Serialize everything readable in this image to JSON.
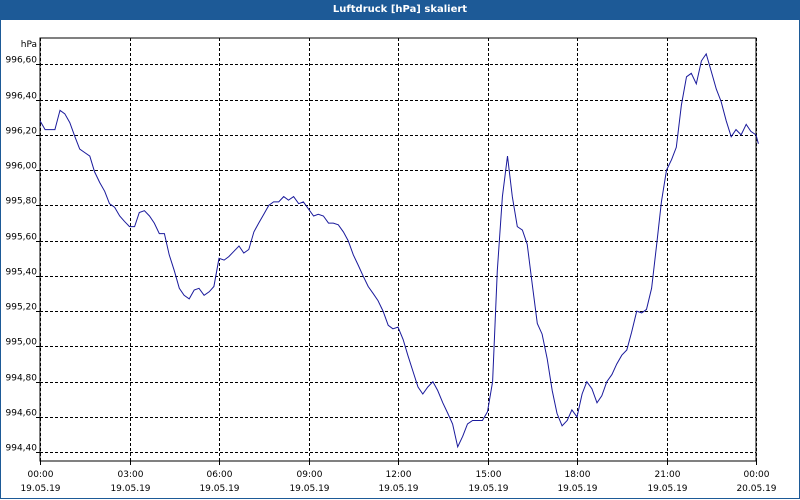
{
  "title": "Luftdruck [hPa] skaliert",
  "colors": {
    "title_bg": "#1d5a97",
    "title_fg": "#ffffff",
    "line": "#1a1a9c",
    "grid": "#000000",
    "frame": "#1d5a97"
  },
  "chart_data": {
    "type": "line",
    "title": "Luftdruck [hPa] skaliert",
    "ylabel": "hPa",
    "xlabel": "",
    "grid": true,
    "xlim": [
      0,
      24
    ],
    "ylim": [
      994.35,
      996.75
    ],
    "y_ticks": [
      994.4,
      994.6,
      994.8,
      995.0,
      995.2,
      995.4,
      995.6,
      995.8,
      996.0,
      996.2,
      996.4,
      996.6
    ],
    "y_tick_labels": [
      "994,40",
      "994,60",
      "994,80",
      "995,00",
      "995,20",
      "995,40",
      "995,60",
      "995,80",
      "996,00",
      "996,20",
      "996,40",
      "996,60"
    ],
    "x_ticks": [
      0,
      3,
      6,
      9,
      12,
      15,
      18,
      21,
      24
    ],
    "x_tick_labels": [
      [
        "00:00",
        "19.05.19"
      ],
      [
        "03:00",
        "19.05.19"
      ],
      [
        "06:00",
        "19.05.19"
      ],
      [
        "09:00",
        "19.05.19"
      ],
      [
        "12:00",
        "19.05.19"
      ],
      [
        "15:00",
        "19.05.19"
      ],
      [
        "18:00",
        "19.05.19"
      ],
      [
        "21:00",
        "19.05.19"
      ],
      [
        "00:00",
        "20.05.19"
      ]
    ],
    "series": [
      {
        "points": [
          [
            0.0,
            996.28
          ],
          [
            0.17,
            996.23
          ],
          [
            0.5,
            996.23
          ],
          [
            0.67,
            996.34
          ],
          [
            0.83,
            996.32
          ],
          [
            1.0,
            996.27
          ],
          [
            1.17,
            996.19
          ],
          [
            1.33,
            996.12
          ],
          [
            1.5,
            996.1
          ],
          [
            1.67,
            996.08
          ],
          [
            1.83,
            995.99
          ],
          [
            2.0,
            995.93
          ],
          [
            2.17,
            995.88
          ],
          [
            2.33,
            995.81
          ],
          [
            2.5,
            995.79
          ],
          [
            2.67,
            995.74
          ],
          [
            2.83,
            995.71
          ],
          [
            3.0,
            995.68
          ],
          [
            3.17,
            995.68
          ],
          [
            3.33,
            995.76
          ],
          [
            3.5,
            995.77
          ],
          [
            3.67,
            995.74
          ],
          [
            3.83,
            995.7
          ],
          [
            4.0,
            995.64
          ],
          [
            4.17,
            995.64
          ],
          [
            4.33,
            995.52
          ],
          [
            4.5,
            995.43
          ],
          [
            4.67,
            995.33
          ],
          [
            4.83,
            995.29
          ],
          [
            5.0,
            995.27
          ],
          [
            5.17,
            995.32
          ],
          [
            5.33,
            995.33
          ],
          [
            5.5,
            995.29
          ],
          [
            5.67,
            995.31
          ],
          [
            5.83,
            995.34
          ],
          [
            6.0,
            995.5
          ],
          [
            6.17,
            995.49
          ],
          [
            6.33,
            995.51
          ],
          [
            6.5,
            995.54
          ],
          [
            6.67,
            995.57
          ],
          [
            6.83,
            995.53
          ],
          [
            7.0,
            995.55
          ],
          [
            7.17,
            995.65
          ],
          [
            7.33,
            995.7
          ],
          [
            7.5,
            995.75
          ],
          [
            7.67,
            995.8
          ],
          [
            7.83,
            995.82
          ],
          [
            8.0,
            995.82
          ],
          [
            8.17,
            995.85
          ],
          [
            8.33,
            995.83
          ],
          [
            8.5,
            995.85
          ],
          [
            8.67,
            995.81
          ],
          [
            8.83,
            995.82
          ],
          [
            9.0,
            995.78
          ],
          [
            9.17,
            995.74
          ],
          [
            9.33,
            995.75
          ],
          [
            9.5,
            995.74
          ],
          [
            9.67,
            995.7
          ],
          [
            9.83,
            995.7
          ],
          [
            10.0,
            995.69
          ],
          [
            10.17,
            995.65
          ],
          [
            10.33,
            995.6
          ],
          [
            10.5,
            995.52
          ],
          [
            10.67,
            995.46
          ],
          [
            10.83,
            995.4
          ],
          [
            11.0,
            995.34
          ],
          [
            11.17,
            995.3
          ],
          [
            11.33,
            995.26
          ],
          [
            11.5,
            995.2
          ],
          [
            11.67,
            995.12
          ],
          [
            11.83,
            995.1
          ],
          [
            12.0,
            995.11
          ],
          [
            12.17,
            995.04
          ],
          [
            12.33,
            994.95
          ],
          [
            12.5,
            994.86
          ],
          [
            12.67,
            994.77
          ],
          [
            12.83,
            994.73
          ],
          [
            13.0,
            994.77
          ],
          [
            13.17,
            994.8
          ],
          [
            13.33,
            994.75
          ],
          [
            13.5,
            994.68
          ],
          [
            13.67,
            994.62
          ],
          [
            13.83,
            994.56
          ],
          [
            14.0,
            994.43
          ],
          [
            14.17,
            994.49
          ],
          [
            14.33,
            994.56
          ],
          [
            14.5,
            994.58
          ],
          [
            14.67,
            994.58
          ],
          [
            14.83,
            994.58
          ],
          [
            15.0,
            994.63
          ],
          [
            15.17,
            994.8
          ],
          [
            15.33,
            995.43
          ],
          [
            15.5,
            995.85
          ],
          [
            15.67,
            996.08
          ],
          [
            15.83,
            995.85
          ],
          [
            16.0,
            995.68
          ],
          [
            16.17,
            995.66
          ],
          [
            16.33,
            995.58
          ],
          [
            16.5,
            995.35
          ],
          [
            16.67,
            995.13
          ],
          [
            16.83,
            995.07
          ],
          [
            17.0,
            994.93
          ],
          [
            17.17,
            994.75
          ],
          [
            17.33,
            994.62
          ],
          [
            17.5,
            994.55
          ],
          [
            17.67,
            994.58
          ],
          [
            17.83,
            994.64
          ],
          [
            18.0,
            994.6
          ],
          [
            18.17,
            994.73
          ],
          [
            18.33,
            994.8
          ],
          [
            18.5,
            994.76
          ],
          [
            18.67,
            994.68
          ],
          [
            18.83,
            994.72
          ],
          [
            19.0,
            994.8
          ],
          [
            19.17,
            994.84
          ],
          [
            19.33,
            994.9
          ],
          [
            19.5,
            994.95
          ],
          [
            19.67,
            994.98
          ],
          [
            19.83,
            995.08
          ],
          [
            20.0,
            995.2
          ],
          [
            20.17,
            995.19
          ],
          [
            20.33,
            995.21
          ],
          [
            20.5,
            995.33
          ],
          [
            20.67,
            995.58
          ],
          [
            20.83,
            995.82
          ],
          [
            21.0,
            996.0
          ],
          [
            21.17,
            996.06
          ],
          [
            21.33,
            996.13
          ],
          [
            21.5,
            996.37
          ],
          [
            21.67,
            996.53
          ],
          [
            21.83,
            996.55
          ],
          [
            22.0,
            996.49
          ],
          [
            22.17,
            996.62
          ],
          [
            22.33,
            996.66
          ],
          [
            22.5,
            996.56
          ],
          [
            22.67,
            996.46
          ],
          [
            22.83,
            996.39
          ],
          [
            23.0,
            996.28
          ],
          [
            23.17,
            996.19
          ],
          [
            23.33,
            996.23
          ],
          [
            23.5,
            996.2
          ],
          [
            23.67,
            996.26
          ],
          [
            23.83,
            996.22
          ],
          [
            24.0,
            996.2
          ],
          [
            24.08,
            996.15
          ]
        ]
      }
    ]
  }
}
